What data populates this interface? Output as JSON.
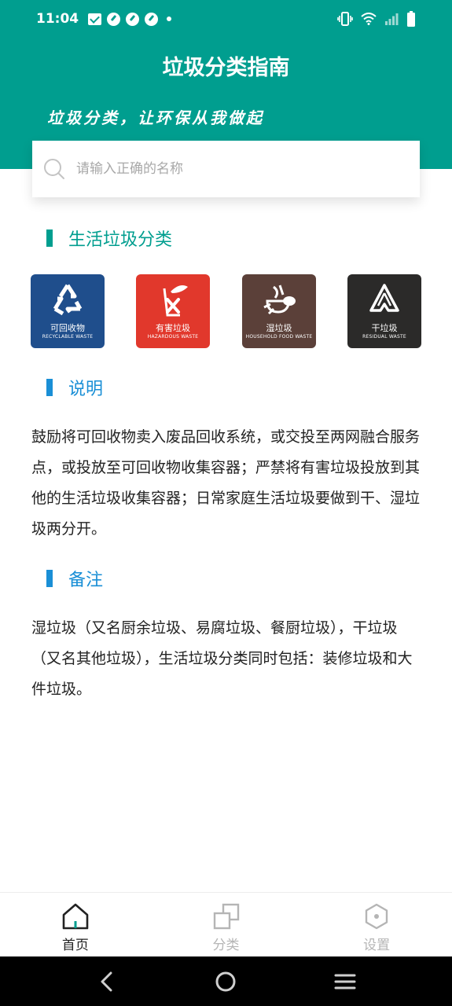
{
  "status_bar": {
    "time": "11:04"
  },
  "header": {
    "title": "垃圾分类指南",
    "slogan": "垃圾分类，让环保从我做起"
  },
  "search": {
    "placeholder": "请输入正确的名称"
  },
  "sections": {
    "life_title": "生活垃圾分类",
    "desc_title": "说明",
    "note_title": "备注"
  },
  "bins": [
    {
      "cn": "可回收物",
      "en": "RECYCLABLE WASTE",
      "color": "#1f4e8c",
      "icon": "recycle-icon"
    },
    {
      "cn": "有害垃圾",
      "en": "HAZARDOUS WASTE",
      "color": "#e1382c",
      "icon": "hazardous-icon"
    },
    {
      "cn": "湿垃圾",
      "en": "HOUSEHOLD FOOD WASTE",
      "color": "#5b4039",
      "icon": "food-waste-icon"
    },
    {
      "cn": "干垃圾",
      "en": "RESIDUAL WASTE",
      "color": "#2b2a29",
      "icon": "residual-icon"
    }
  ],
  "description": "鼓励将可回收物卖入废品回收系统，或交投至两网融合服务点，或投放至可回收物收集容器；严禁将有害垃圾投放到其他的生活垃圾收集容器；日常家庭生活垃圾要做到干、湿垃圾两分开。",
  "note": "湿垃圾（又名厨余垃圾、易腐垃圾、餐厨垃圾），干垃圾（又名其他垃圾），生活垃圾分类同时包括：装修垃圾和大件垃圾。",
  "tabs": [
    {
      "label": "首页",
      "icon": "home-icon",
      "active": true
    },
    {
      "label": "分类",
      "icon": "category-icon",
      "active": false
    },
    {
      "label": "设置",
      "icon": "settings-icon",
      "active": false
    }
  ],
  "colors": {
    "primary": "#009e8f",
    "accent": "#1a8fd6",
    "inactive": "#b5b5b5"
  }
}
